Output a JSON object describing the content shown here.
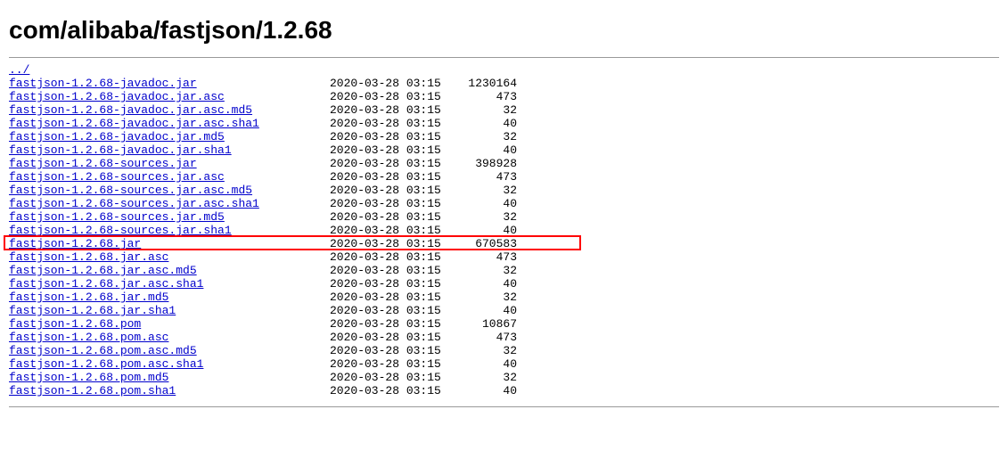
{
  "header": {
    "title": "com/alibaba/fastjson/1.2.68"
  },
  "parent_link": "../",
  "highlight_index": 12,
  "files": [
    {
      "name": "fastjson-1.2.68-javadoc.jar",
      "date": "2020-03-28 03:15",
      "size": "1230164"
    },
    {
      "name": "fastjson-1.2.68-javadoc.jar.asc",
      "date": "2020-03-28 03:15",
      "size": "473"
    },
    {
      "name": "fastjson-1.2.68-javadoc.jar.asc.md5",
      "date": "2020-03-28 03:15",
      "size": "32"
    },
    {
      "name": "fastjson-1.2.68-javadoc.jar.asc.sha1",
      "date": "2020-03-28 03:15",
      "size": "40"
    },
    {
      "name": "fastjson-1.2.68-javadoc.jar.md5",
      "date": "2020-03-28 03:15",
      "size": "32"
    },
    {
      "name": "fastjson-1.2.68-javadoc.jar.sha1",
      "date": "2020-03-28 03:15",
      "size": "40"
    },
    {
      "name": "fastjson-1.2.68-sources.jar",
      "date": "2020-03-28 03:15",
      "size": "398928"
    },
    {
      "name": "fastjson-1.2.68-sources.jar.asc",
      "date": "2020-03-28 03:15",
      "size": "473"
    },
    {
      "name": "fastjson-1.2.68-sources.jar.asc.md5",
      "date": "2020-03-28 03:15",
      "size": "32"
    },
    {
      "name": "fastjson-1.2.68-sources.jar.asc.sha1",
      "date": "2020-03-28 03:15",
      "size": "40"
    },
    {
      "name": "fastjson-1.2.68-sources.jar.md5",
      "date": "2020-03-28 03:15",
      "size": "32"
    },
    {
      "name": "fastjson-1.2.68-sources.jar.sha1",
      "date": "2020-03-28 03:15",
      "size": "40"
    },
    {
      "name": "fastjson-1.2.68.jar",
      "date": "2020-03-28 03:15",
      "size": "670583"
    },
    {
      "name": "fastjson-1.2.68.jar.asc",
      "date": "2020-03-28 03:15",
      "size": "473"
    },
    {
      "name": "fastjson-1.2.68.jar.asc.md5",
      "date": "2020-03-28 03:15",
      "size": "32"
    },
    {
      "name": "fastjson-1.2.68.jar.asc.sha1",
      "date": "2020-03-28 03:15",
      "size": "40"
    },
    {
      "name": "fastjson-1.2.68.jar.md5",
      "date": "2020-03-28 03:15",
      "size": "32"
    },
    {
      "name": "fastjson-1.2.68.jar.sha1",
      "date": "2020-03-28 03:15",
      "size": "40"
    },
    {
      "name": "fastjson-1.2.68.pom",
      "date": "2020-03-28 03:15",
      "size": "10867"
    },
    {
      "name": "fastjson-1.2.68.pom.asc",
      "date": "2020-03-28 03:15",
      "size": "473"
    },
    {
      "name": "fastjson-1.2.68.pom.asc.md5",
      "date": "2020-03-28 03:15",
      "size": "32"
    },
    {
      "name": "fastjson-1.2.68.pom.asc.sha1",
      "date": "2020-03-28 03:15",
      "size": "40"
    },
    {
      "name": "fastjson-1.2.68.pom.md5",
      "date": "2020-03-28 03:15",
      "size": "32"
    },
    {
      "name": "fastjson-1.2.68.pom.sha1",
      "date": "2020-03-28 03:15",
      "size": "40"
    }
  ]
}
